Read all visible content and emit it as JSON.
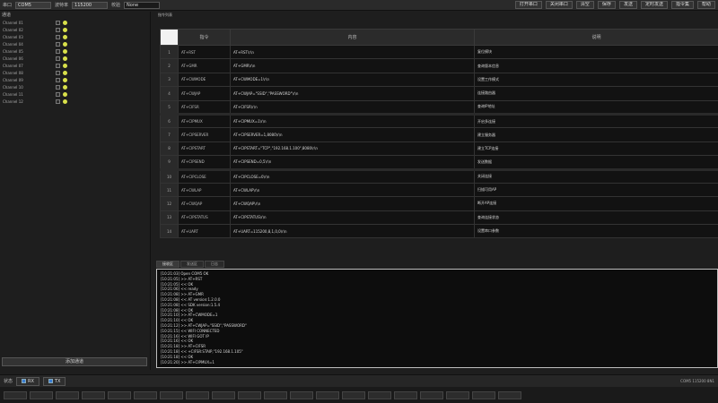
{
  "toolbar": {
    "port_label": "串口",
    "port_value": "COM5",
    "baud_label": "波特率",
    "baud_value": "115200",
    "parity_label": "校验",
    "parity_value": "None",
    "buttons": [
      "打开串口",
      "关闭串口",
      "清空",
      "保存",
      "发送",
      "定时发送",
      "指令集",
      "帮助"
    ]
  },
  "left": {
    "title": "通道",
    "channels": [
      "Channel 01",
      "Channel 02",
      "Channel 03",
      "Channel 04",
      "Channel 05",
      "Channel 06",
      "Channel 07",
      "Channel 08",
      "Channel 09",
      "Channel 10",
      "Channel 11",
      "Channel 12"
    ],
    "bottom_button": "添加通道"
  },
  "main": {
    "title": "指令列表",
    "columns": [
      "指令",
      "内容",
      "说明"
    ],
    "rows": [
      {
        "idx": "1",
        "code": "AT+RST",
        "content": "AT+RST\\r\\n",
        "desc": "复位模块"
      },
      {
        "idx": "2",
        "code": "AT+GMR",
        "content": "AT+GMR\\r\\n",
        "desc": "查询版本信息"
      },
      {
        "idx": "3",
        "code": "AT+CWMODE",
        "content": "AT+CWMODE=1\\r\\n",
        "desc": "设置工作模式"
      },
      {
        "idx": "4",
        "code": "AT+CWJAP",
        "content": "AT+CWJAP=\"SSID\",\"PASSWORD\"\\r\\n",
        "desc": "连接路由器"
      },
      {
        "idx": "5",
        "code": "AT+CIFSR",
        "content": "AT+CIFSR\\r\\n",
        "desc": "查询IP地址"
      },
      {
        "idx": "6",
        "code": "AT+CIPMUX",
        "content": "AT+CIPMUX=1\\r\\n",
        "desc": "开启多连接"
      },
      {
        "idx": "7",
        "code": "AT+CIPSERVER",
        "content": "AT+CIPSERVER=1,8080\\r\\n",
        "desc": "建立服务器"
      },
      {
        "idx": "8",
        "code": "AT+CIPSTART",
        "content": "AT+CIPSTART=\"TCP\",\"192.168.1.100\",8080\\r\\n",
        "desc": "建立TCP连接"
      },
      {
        "idx": "9",
        "code": "AT+CIPSEND",
        "content": "AT+CIPSEND=0,5\\r\\n",
        "desc": "发送数据"
      },
      {
        "idx": "10",
        "code": "AT+CIPCLOSE",
        "content": "AT+CIPCLOSE=0\\r\\n",
        "desc": "关闭连接"
      },
      {
        "idx": "11",
        "code": "AT+CWLAP",
        "content": "AT+CWLAP\\r\\n",
        "desc": "扫描可用AP"
      },
      {
        "idx": "12",
        "code": "AT+CWQAP",
        "content": "AT+CWQAP\\r\\n",
        "desc": "断开AP连接"
      },
      {
        "idx": "13",
        "code": "AT+CIPSTATUS",
        "content": "AT+CIPSTATUS\\r\\n",
        "desc": "查询连接状态"
      },
      {
        "idx": "14",
        "code": "AT+UART",
        "content": "AT+UART=115200,8,1,0,0\\r\\n",
        "desc": "设置串口参数"
      }
    ]
  },
  "log": {
    "tabs": [
      "接收区",
      "发送区",
      "日志"
    ],
    "lines": [
      "[10:21:03] Open COM5 OK",
      "[10:21:05] >> AT+RST",
      "[10:21:05] << OK",
      "[10:21:06] << ready",
      "[10:21:08] >> AT+GMR",
      "[10:21:08] << AT version:1.2.0.0",
      "[10:21:08] << SDK version:1.5.4",
      "[10:21:08] << OK",
      "[10:21:10] >> AT+CWMODE=1",
      "[10:21:10] << OK",
      "[10:21:12] >> AT+CWJAP=\"SSID\",\"PASSWORD\"",
      "[10:21:15] << WIFI CONNECTED",
      "[10:21:16] << WIFI GOT IP",
      "[10:21:16] << OK",
      "[10:21:18] >> AT+CIFSR",
      "[10:21:18] << +CIFSR:STAIP,\"192.168.1.105\"",
      "[10:21:18] << OK",
      "[10:21:20] >> AT+CIPMUX=1"
    ]
  },
  "status": {
    "label": "状态",
    "buttons": [
      "RX",
      "TX"
    ],
    "right_text": "COM5 115200 8N1"
  },
  "colors": {
    "accent": "#3b7fd4",
    "indicator": "#d8e04a"
  }
}
